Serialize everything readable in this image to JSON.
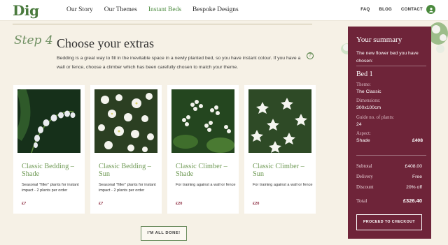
{
  "header": {
    "logo": "Dig",
    "nav": [
      "Our Story",
      "Our Themes",
      "Instant Beds",
      "Bespoke Designs"
    ],
    "nav_active_index": 2,
    "util": [
      "FAQ",
      "BLOG",
      "CONTACT"
    ]
  },
  "step": {
    "label": "Step 4",
    "title": "Choose your extras",
    "intro": "Bedding is a great way to fill in the inevitable space in a newly planted bed, so you have instant colour. If you have a wall or fence, choose a climber which has been carefully chosen to match your theme.",
    "help": "?"
  },
  "cards": [
    {
      "title": "Classic Bedding – Shade",
      "desc": "Seasonal \"filler\" plants for instant impact - 2 plants per order",
      "price": "£7"
    },
    {
      "title": "Classic Bedding – Sun",
      "desc": "Seasonal \"filler\" plants for instant impact - 2 plants per order",
      "price": "£7"
    },
    {
      "title": "Classic Climber – Shade",
      "desc": "For training against a wall or fence",
      "price": "£20"
    },
    {
      "title": "Classic Climber – Sun",
      "desc": "For training against a wall or fence",
      "price": "£20"
    }
  ],
  "done_button": "I'M ALL DONE!",
  "summary": {
    "heading": "Your summary",
    "subtitle": "The new flower bed you have chosen:",
    "bed_name": "Bed 1",
    "theme_label": "Theme:",
    "theme_value": "The Classic",
    "dimensions_label": "Dimensions:",
    "dimensions_value": "300x100cm",
    "guide_label": "Guide no. of plants:",
    "guide_value": "24",
    "aspect_label": "Aspect:",
    "aspect_value": "Shade",
    "bed_price": "£408",
    "subtotal_label": "Subtotal",
    "subtotal_value": "£408.00",
    "delivery_label": "Delivery",
    "delivery_value": "Free",
    "discount_label": "Discount",
    "discount_value": "20% off",
    "total_label": "Total",
    "total_value": "£326.40",
    "checkout_label": "PROCEED TO CHECKOUT"
  },
  "colors": {
    "brand_green": "#4a7a3d",
    "summary_bg": "#6e2439",
    "price": "#8c2a3e",
    "page_bg": "#f6f1e6"
  }
}
